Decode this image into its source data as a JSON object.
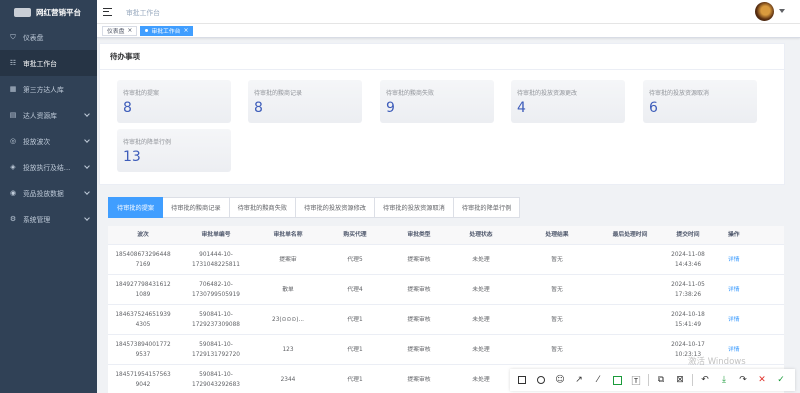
{
  "app": {
    "title": "网红营销平台"
  },
  "sidebar": {
    "items": [
      {
        "label": "仪表盘",
        "icon": "dashboard-icon",
        "glyph": "⛉"
      },
      {
        "label": "审批工作台",
        "icon": "approval-icon",
        "glyph": "☷",
        "active": true
      },
      {
        "label": "第三方达人库",
        "icon": "grid-icon",
        "glyph": "▦"
      },
      {
        "label": "达人资源库",
        "icon": "book-icon",
        "glyph": "▤",
        "chevron": true
      },
      {
        "label": "投放波次",
        "icon": "wave-icon",
        "glyph": "◎",
        "chevron": true
      },
      {
        "label": "投放执行及结...",
        "icon": "execution-icon",
        "glyph": "◈",
        "chevron": true
      },
      {
        "label": "竞品投放数据",
        "icon": "compete-icon",
        "glyph": "◉",
        "chevron": true
      },
      {
        "label": "系统管理",
        "icon": "settings-icon",
        "glyph": "⚙",
        "chevron": true
      }
    ]
  },
  "header": {
    "breadcrumb": "审批工作台"
  },
  "tags": [
    {
      "label": "仪表盘",
      "active": false
    },
    {
      "label": "审批工作台",
      "active": true
    }
  ],
  "todo": {
    "title": "待办事项",
    "stats": [
      {
        "label": "待审批的提案",
        "value": "8"
      },
      {
        "label": "待审批的黢商记录",
        "value": "8"
      },
      {
        "label": "待审批的黢商失败",
        "value": "9"
      },
      {
        "label": "待审批的投放资源更改",
        "value": "4"
      },
      {
        "label": "待审批的投放资源取消",
        "value": "6"
      },
      {
        "label": "待审批的降单行例",
        "value": "13"
      }
    ]
  },
  "tabs": [
    {
      "label": "待审批的提案",
      "active": true
    },
    {
      "label": "待审批的黢商记录"
    },
    {
      "label": "待审批的黢商失败"
    },
    {
      "label": "待审批的投放资源修改"
    },
    {
      "label": "待审批的投放资源取消"
    },
    {
      "label": "待审批的降单行例"
    }
  ],
  "table": {
    "headers": [
      "波次",
      "审批单编号",
      "审批单名称",
      "购买代理",
      "审批类型",
      "处理状态",
      "处理结果",
      "最后处理时间",
      "提交时间",
      "操作"
    ],
    "rows": [
      {
        "wave": [
          "185408673296448",
          "7169"
        ],
        "code": [
          "901444-10-",
          "1731048225811"
        ],
        "name": "提案审",
        "agent": "代理5",
        "type": "提案审核",
        "status": "未处理",
        "result": "暂无",
        "last": "",
        "submit": [
          "2024-11-08",
          "14:43:46"
        ],
        "action": "详情"
      },
      {
        "wave": [
          "184927798431612",
          "1089"
        ],
        "code": [
          "706482-10-",
          "1730799505919"
        ],
        "name": "散单",
        "agent": "代理4",
        "type": "提案审核",
        "status": "未处理",
        "result": "暂无",
        "last": "",
        "submit": [
          "2024-11-05",
          "17:38:26"
        ],
        "action": "详情"
      },
      {
        "wave": [
          "184637524651939",
          "4305"
        ],
        "code": [
          "590841-10-",
          "1729237309088"
        ],
        "name": "23(⊙⊙⊙)...",
        "agent": "代理1",
        "type": "提案审核",
        "status": "未处理",
        "result": "暂无",
        "last": "",
        "submit": [
          "2024-10-18",
          "15:41:49"
        ],
        "action": "详情"
      },
      {
        "wave": [
          "184573894001772",
          "9537"
        ],
        "code": [
          "590841-10-",
          "1729131792720"
        ],
        "name": "123",
        "agent": "代理1",
        "type": "提案审核",
        "status": "未处理",
        "result": "暂无",
        "last": "",
        "submit": [
          "2024-10-17",
          "10:23:13"
        ],
        "action": "详情"
      },
      {
        "wave": [
          "184571954157563",
          "9042"
        ],
        "code": [
          "590841-10-",
          "1729043292683"
        ],
        "name": "2344",
        "agent": "代理1",
        "type": "提案审核",
        "status": "未处理",
        "result": "暂无",
        "last": "",
        "submit": [
          "",
          ""
        ],
        "action": ""
      }
    ]
  },
  "watermark": "激活 Windows",
  "colors": {
    "sidebar_bg": "#304156",
    "accent": "#409eff",
    "stat_number": "#3e5dba"
  }
}
